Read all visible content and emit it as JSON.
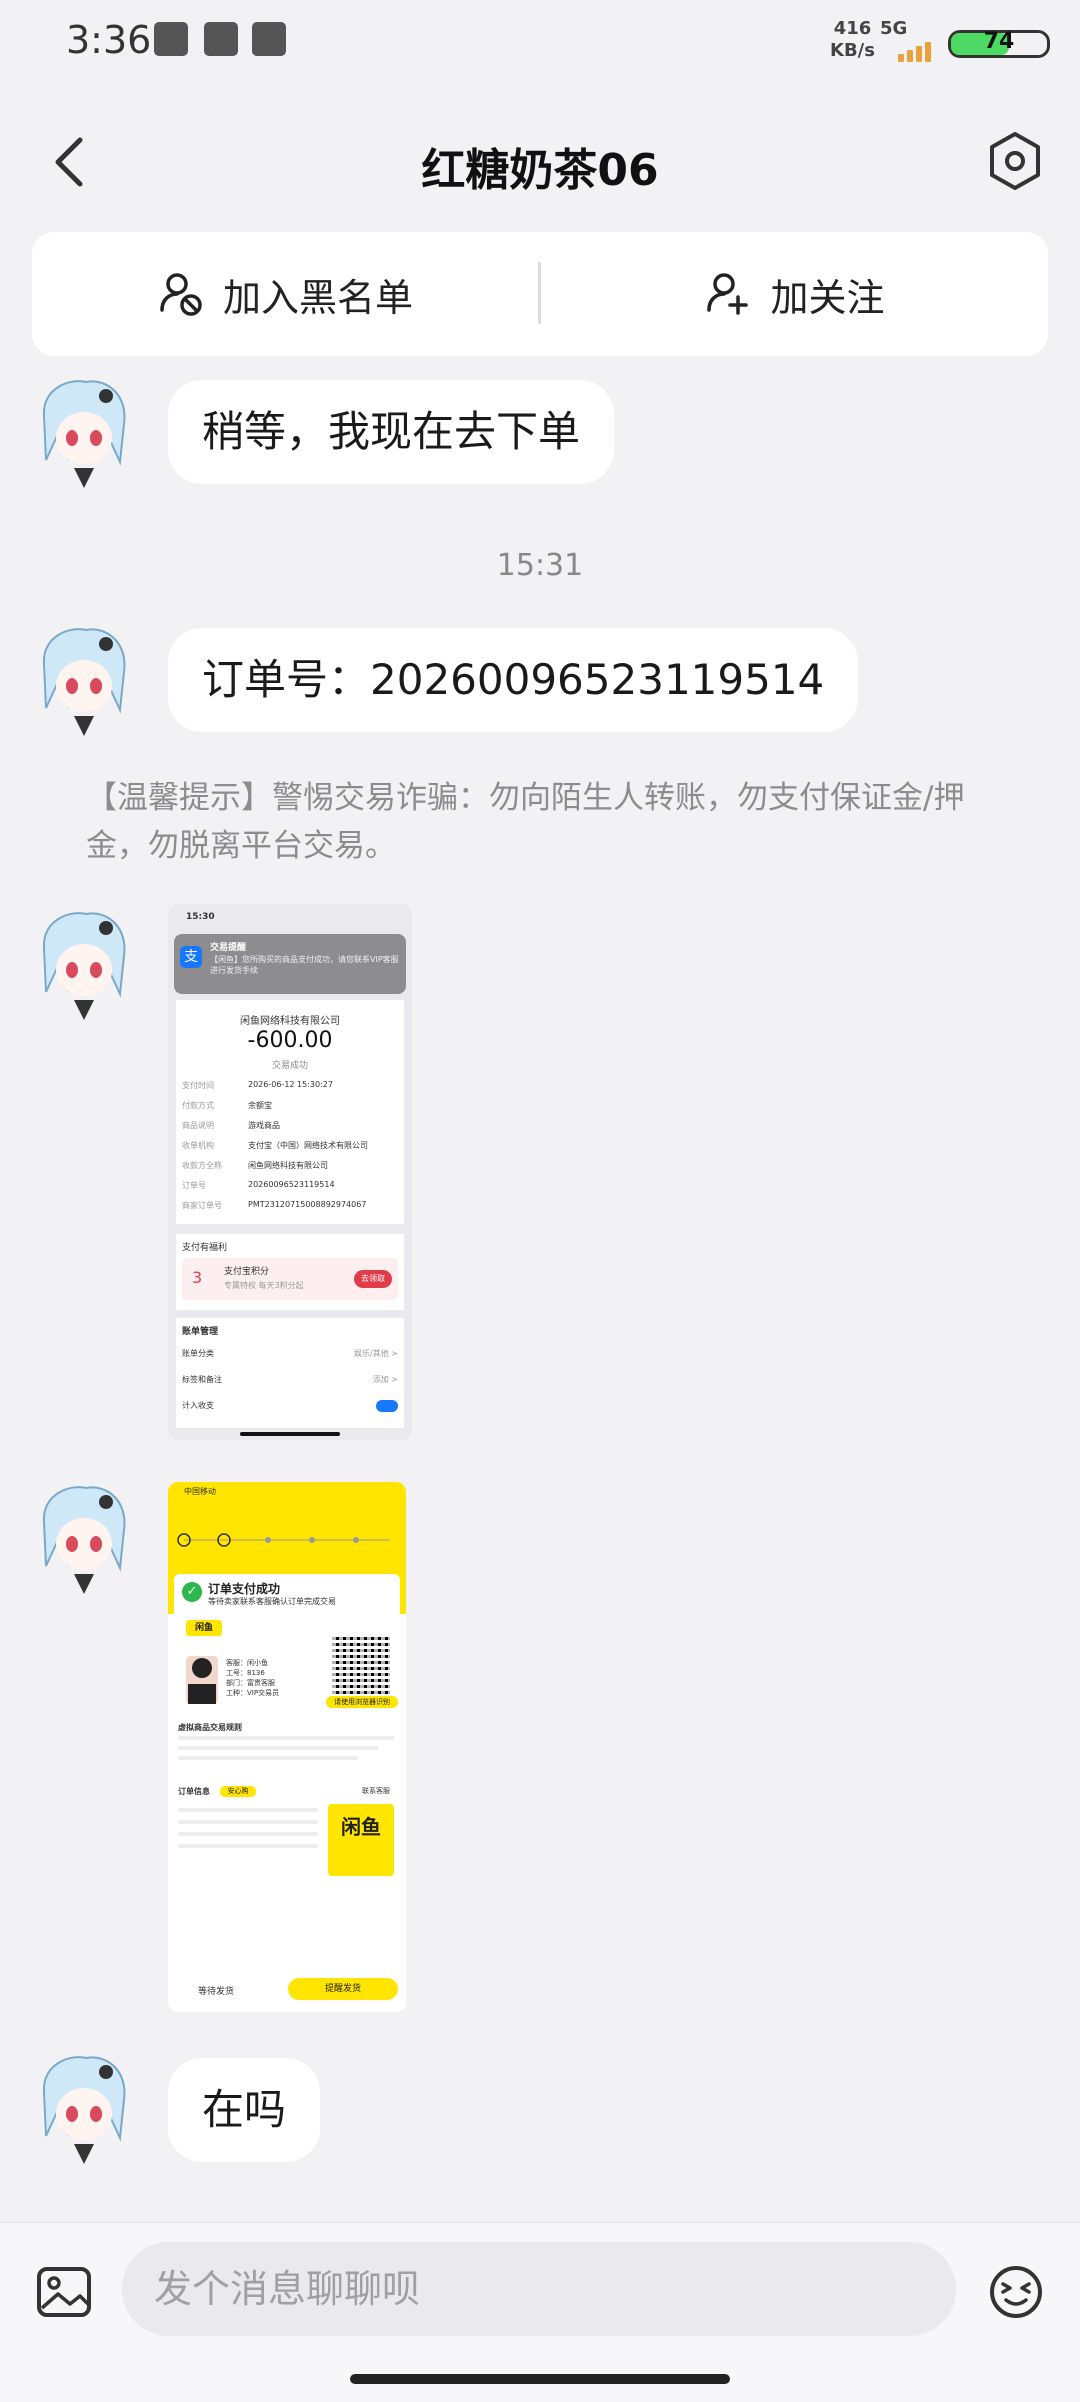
{
  "status": {
    "time": "3:36",
    "speed_value": "416",
    "speed_unit": "KB/s",
    "network": "5G",
    "battery": "74"
  },
  "header": {
    "back_icon": "chevron-left-icon",
    "title": "红糖奶茶06",
    "settings_icon": "hexagon-settings-icon"
  },
  "actions": {
    "block_label": "加入黑名单",
    "follow_label": "加关注"
  },
  "messages": {
    "msg1": "稍等，我现在去下单",
    "time1": "15:31",
    "msg2": "订单号：2026009652311951 4",
    "msg2_text": "订单号：20260096523119514",
    "warning": "【温馨提示】警惕交易诈骗：勿向陌生人转账，勿支付保证金/押金，勿脱离平台交易。",
    "msg_last": "在吗"
  },
  "shot1": {
    "time": "15:30",
    "notice_title": "交易提醒",
    "notice_text": "【闲鱼】您所购买的商品支付成功，请您联系VIP客服进行发货手续",
    "company": "闲鱼网络科技有限公司",
    "amount": "-600.00",
    "status": "交易成功",
    "rows": [
      {
        "k": "支付时间",
        "v": "2026-06-12 15:30:27"
      },
      {
        "k": "付款方式",
        "v": "余额宝"
      },
      {
        "k": "商品说明",
        "v": "游戏商品"
      },
      {
        "k": "收单机构",
        "v": "支付宝（中国）网络技术有限公司"
      },
      {
        "k": "收款方全称",
        "v": "闲鱼网络科技有限公司"
      },
      {
        "k": "订单号",
        "v": "20260096523119514"
      },
      {
        "k": "商家订单号",
        "v": "PMT23120715008892974067"
      }
    ],
    "benefit": "支付有福利",
    "points_count": "3",
    "points_title": "支付宝积分",
    "points_sub": "专属特权 每天3积分起",
    "points_btn": "去领取",
    "bill_title": "账单管理",
    "bill_rows": [
      {
        "k": "账单分类",
        "v": "娱乐/其他 >"
      },
      {
        "k": "标签和备注",
        "v": "添加 >"
      },
      {
        "k": "计入收支",
        "v": ""
      }
    ]
  },
  "shot2": {
    "carrier": "中国移动",
    "paid_title": "订单支付成功",
    "paid_sub": "等待卖家联系客服确认订单完成交易",
    "tag": "闲鱼",
    "staff_name": "客服：闲小鱼",
    "staff_id": "工号：8136",
    "staff_dept": "部门：富贵客服",
    "staff_type": "工种：VIP交易员",
    "browser_btn": "请使用浏览器识别",
    "rule_title": "虚拟商品交易规则",
    "order_title": "订单信息",
    "safe_tag": "安心购",
    "contact": "联系客服",
    "logo": "闲鱼",
    "btn_wait": "等待发货",
    "btn_remind": "提醒发货"
  },
  "input": {
    "placeholder": "发个消息聊聊呗"
  },
  "colors": {
    "background": "#f2f2f4",
    "bubble": "#ffffff",
    "xianyu_yellow": "#ffe500",
    "alipay_blue": "#1677ff"
  }
}
